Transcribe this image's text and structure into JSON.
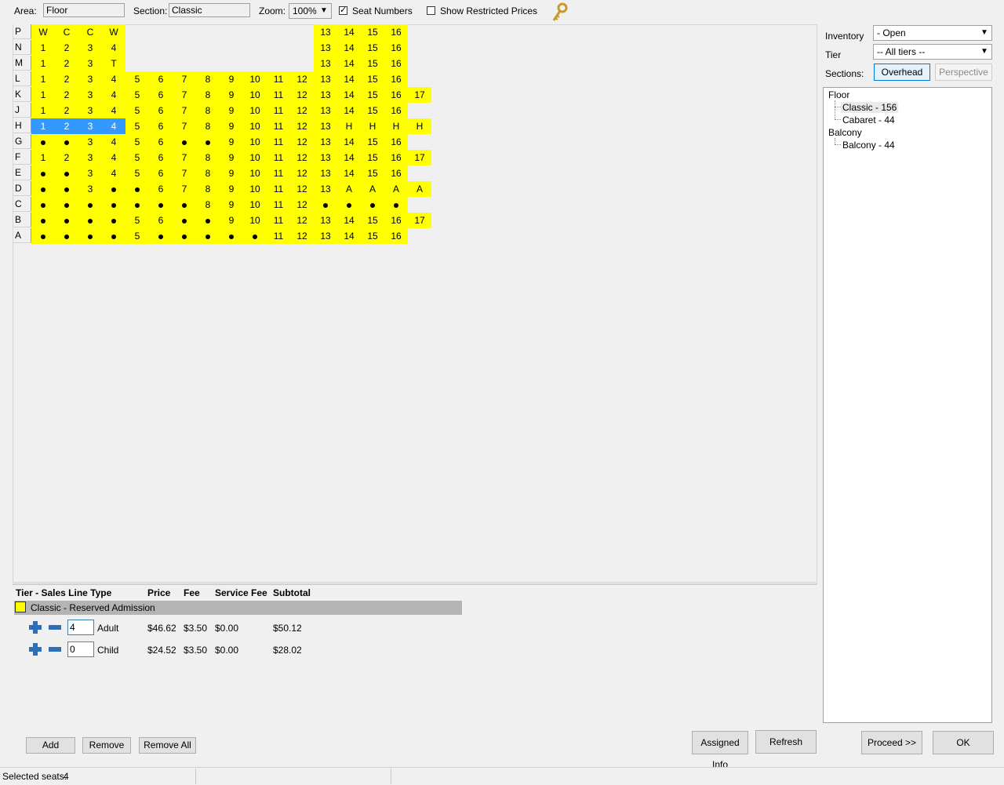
{
  "toolbar": {
    "area_label": "Area:",
    "area_value": "Floor",
    "section_label": "Section:",
    "section_value": "Classic",
    "zoom_label": "Zoom:",
    "zoom_value": "100%",
    "seat_numbers_label": "Seat Numbers",
    "seat_numbers_checked": true,
    "show_restricted_label": "Show Restricted Prices",
    "show_restricted_checked": false,
    "key_icon": "key-icon"
  },
  "seatmap": {
    "seat_color": "#ffff00",
    "selected_color": "#3399ff",
    "rows": [
      {
        "label": "P",
        "seats": [
          "W",
          "C",
          "C",
          "W",
          "",
          "",
          "",
          "",
          "",
          "",
          "",
          "",
          "13",
          "14",
          "15",
          "16",
          ""
        ]
      },
      {
        "label": "N",
        "seats": [
          "1",
          "2",
          "3",
          "4",
          "",
          "",
          "",
          "",
          "",
          "",
          "",
          "",
          "13",
          "14",
          "15",
          "16",
          ""
        ]
      },
      {
        "label": "M",
        "seats": [
          "1",
          "2",
          "3",
          "T",
          "",
          "",
          "",
          "",
          "",
          "",
          "",
          "",
          "13",
          "14",
          "15",
          "16",
          ""
        ]
      },
      {
        "label": "L",
        "seats": [
          "1",
          "2",
          "3",
          "4",
          "5",
          "6",
          "7",
          "8",
          "9",
          "10",
          "11",
          "12",
          "13",
          "14",
          "15",
          "16",
          ""
        ]
      },
      {
        "label": "K",
        "seats": [
          "1",
          "2",
          "3",
          "4",
          "5",
          "6",
          "7",
          "8",
          "9",
          "10",
          "11",
          "12",
          "13",
          "14",
          "15",
          "16",
          "17"
        ]
      },
      {
        "label": "J",
        "seats": [
          "1",
          "2",
          "3",
          "4",
          "5",
          "6",
          "7",
          "8",
          "9",
          "10",
          "11",
          "12",
          "13",
          "14",
          "15",
          "16",
          ""
        ]
      },
      {
        "label": "H",
        "seats": [
          "1",
          "2",
          "3",
          "4",
          "5",
          "6",
          "7",
          "8",
          "9",
          "10",
          "11",
          "12",
          "13",
          "H",
          "H",
          "H",
          "H"
        ],
        "selected": [
          0,
          1,
          2,
          3
        ]
      },
      {
        "label": "G",
        "seats": [
          "•",
          "•",
          "3",
          "4",
          "5",
          "6",
          "•",
          "•",
          "9",
          "10",
          "11",
          "12",
          "13",
          "14",
          "15",
          "16",
          ""
        ]
      },
      {
        "label": "F",
        "seats": [
          "1",
          "2",
          "3",
          "4",
          "5",
          "6",
          "7",
          "8",
          "9",
          "10",
          "11",
          "12",
          "13",
          "14",
          "15",
          "16",
          "17"
        ]
      },
      {
        "label": "E",
        "seats": [
          "•",
          "•",
          "3",
          "4",
          "5",
          "6",
          "7",
          "8",
          "9",
          "10",
          "11",
          "12",
          "13",
          "14",
          "15",
          "16",
          ""
        ]
      },
      {
        "label": "D",
        "seats": [
          "•",
          "•",
          "3",
          "•",
          "•",
          "6",
          "7",
          "8",
          "9",
          "10",
          "11",
          "12",
          "13",
          "A",
          "A",
          "A",
          "A"
        ]
      },
      {
        "label": "C",
        "seats": [
          "•",
          "•",
          "•",
          "•",
          "•",
          "•",
          "•",
          "8",
          "9",
          "10",
          "11",
          "12",
          "•",
          "•",
          "•",
          "•",
          ""
        ]
      },
      {
        "label": "B",
        "seats": [
          "•",
          "•",
          "•",
          "•",
          "5",
          "6",
          "•",
          "•",
          "9",
          "10",
          "11",
          "12",
          "13",
          "14",
          "15",
          "16",
          "17"
        ]
      },
      {
        "label": "A",
        "seats": [
          "•",
          "•",
          "•",
          "•",
          "5",
          "•",
          "•",
          "•",
          "•",
          "•",
          "11",
          "12",
          "13",
          "14",
          "15",
          "16",
          ""
        ]
      }
    ]
  },
  "sales": {
    "headers": {
      "tier": "Tier - Sales Line Type",
      "price": "Price",
      "fee": "Fee",
      "service_fee": "Service Fee",
      "subtotal": "Subtotal"
    },
    "group_label": "Classic - Reserved Admission",
    "lines": [
      {
        "qty": "4",
        "type": "Adult",
        "price": "$46.62",
        "fee": "$3.50",
        "service_fee": "$0.00",
        "subtotal": "$50.12"
      },
      {
        "qty": "0",
        "type": "Child",
        "price": "$24.52",
        "fee": "$3.50",
        "service_fee": "$0.00",
        "subtotal": "$28.02"
      }
    ]
  },
  "right": {
    "inventory_label": "Inventory",
    "inventory_value": "- Open",
    "tier_label": "Tier",
    "tier_value": "-- All tiers --",
    "sections_label": "Sections:",
    "overhead_button": "Overhead",
    "perspective_button": "Perspective",
    "tree": [
      {
        "label": "Floor",
        "children": [
          "Classic - 156",
          "Cabaret - 44"
        ]
      },
      {
        "label": "Balcony",
        "children": [
          "Balcony - 44"
        ]
      }
    ]
  },
  "buttons": {
    "add": "Add",
    "remove": "Remove",
    "remove_all": "Remove All",
    "assigned_info": "Assigned Info",
    "refresh": "Refresh",
    "proceed": "Proceed >>",
    "ok": "OK"
  },
  "status": {
    "selected_seats_label": "Selected seats:",
    "selected_seats_count": "4"
  }
}
